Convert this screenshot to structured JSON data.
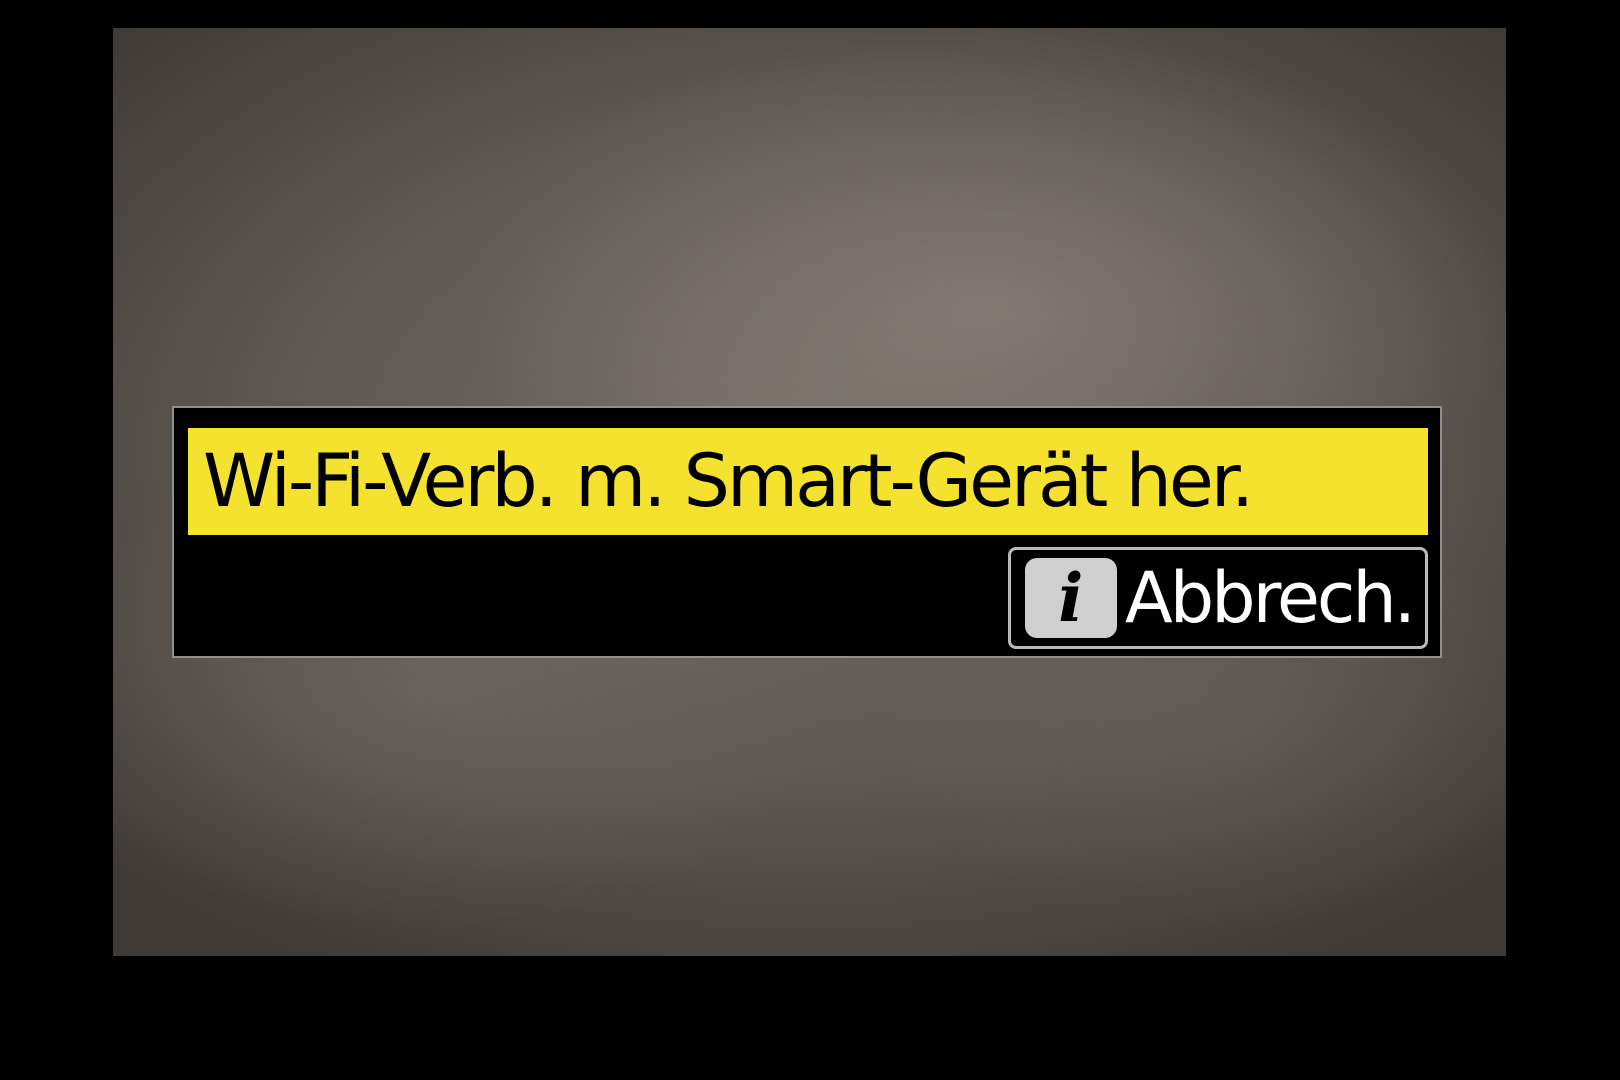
{
  "dialog": {
    "title": "Wi-Fi-Verb. m. Smart-Gerät her.",
    "cancel": {
      "key_glyph": "i",
      "key_icon": "info-i-key-icon",
      "label": "Abbrech."
    }
  },
  "colors": {
    "screen_background": "#000000",
    "highlight": "#f5e22e",
    "dialog_background": "#000000",
    "dialog_border": "#8f8f8f",
    "key_background": "#cfcfcf",
    "label_text": "#ffffff"
  }
}
